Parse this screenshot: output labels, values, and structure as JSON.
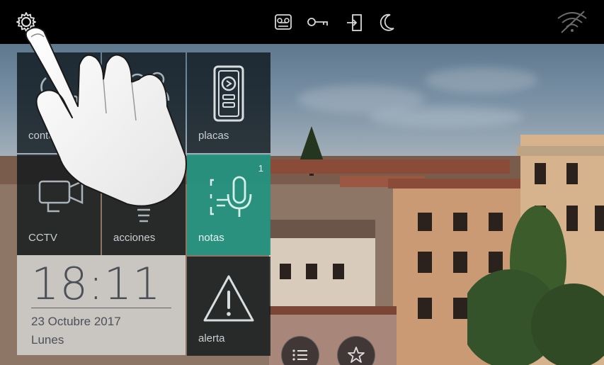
{
  "status_bar": {
    "icons": [
      "gear-icon",
      "voicemail-icon",
      "key-icon",
      "door-exit-icon",
      "moon-icon",
      "wifi-off-icon"
    ]
  },
  "tiles": [
    {
      "id": "contestador",
      "label": "contestador",
      "icon": "answering-machine-icon"
    },
    {
      "id": "intercomunicador",
      "label": "intercomuni cador",
      "icon": "users-icon"
    },
    {
      "id": "placas",
      "label": "placas",
      "icon": "door-panel-icon"
    },
    {
      "id": "cctv",
      "label": "CCTV",
      "icon": "camera-icon"
    },
    {
      "id": "acciones",
      "label": "acciones",
      "icon": "lightbulb-icon"
    },
    {
      "id": "notas",
      "label": "notas",
      "icon": "voice-note-icon",
      "badge": "1"
    },
    {
      "id": "alerta",
      "label": "alerta",
      "icon": "warning-icon"
    }
  ],
  "clock": {
    "time": "18:11",
    "date": "23 Octubre 2017",
    "day": "Lunes"
  },
  "bottom_buttons": [
    "list-icon",
    "star-icon"
  ],
  "colors": {
    "accent": "#21947f",
    "tile_bg": "#0c141a",
    "clock_bg": "#e1e3e5"
  }
}
